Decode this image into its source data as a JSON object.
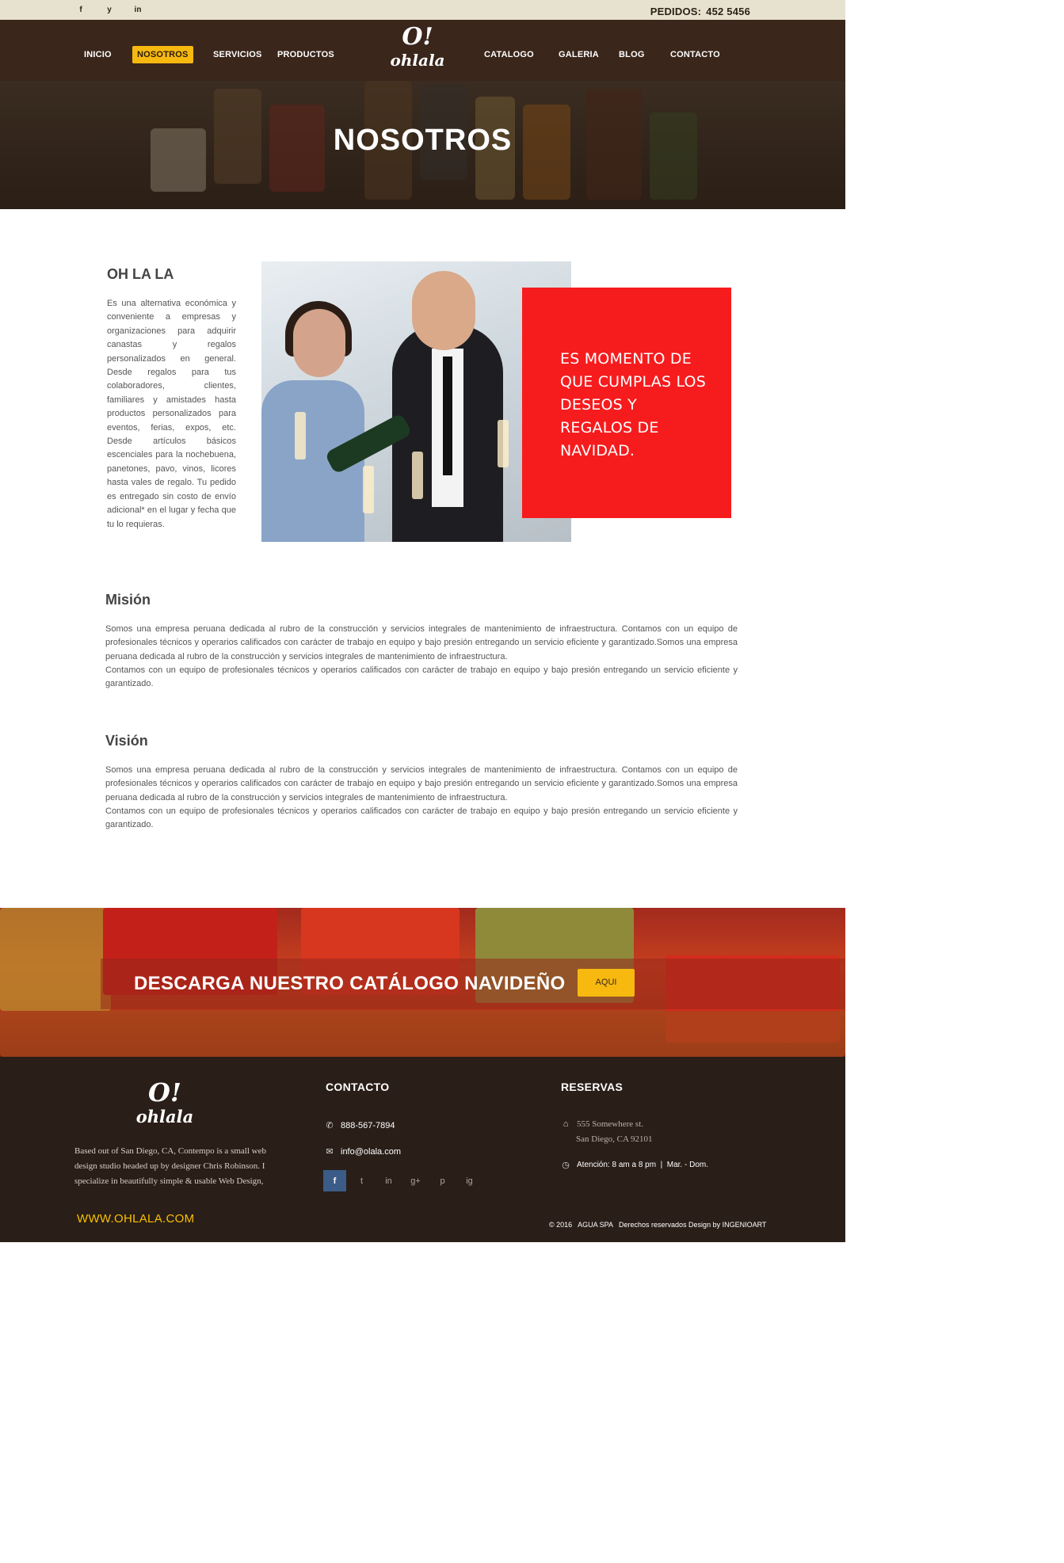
{
  "topbar": {
    "social": [
      "f",
      "y",
      "in"
    ],
    "pedidos_label": "PEDIDOS:",
    "pedidos_number": "452 5456"
  },
  "nav": {
    "items": [
      "INICIO",
      "NOSOTROS",
      "SERVICIOS",
      "PRODUCTOS",
      "CATALOGO",
      "GALERIA",
      "BLOG",
      "CONTACTO"
    ],
    "active": "NOSOTROS",
    "logo_mark": "O!",
    "logo_text": "ohlala"
  },
  "hero": {
    "title": "NOSOTROS"
  },
  "about": {
    "title": "OH LA LA",
    "text": "Es una alternativa económica y conveniente a empresas y organizaciones para adquirir canastas y regalos personalizados en general. Desde regalos para tus colaboradores, clientes, familiares y amistades hasta productos personalizados para eventos, ferias, expos, etc. Desde artículos básicos escenciales para la nochebuena, panetones, pavo, vinos, licores hasta vales de regalo. Tu pedido es entregado sin costo de envío adicional* en el lugar y fecha que tu lo requieras.",
    "highlight": "ES MOMENTO DE QUE CUMPLAS LOS DESEOS Y REGALOS DE NAVIDAD."
  },
  "mision": {
    "title": "Misión",
    "text": "Somos una empresa peruana dedicada al rubro de la construcción y servicios integrales de mantenimiento de infraestructura. Contamos con un equipo de profesionales técnicos y operarios calificados con carácter de trabajo en equipo y bajo presión entregando un servicio eficiente y garantizado.Somos una empresa peruana dedicada al rubro de la construcción y servicios integrales de mantenimiento de infraestructura.",
    "text2": "Contamos con un equipo de profesionales técnicos y operarios calificados con carácter de trabajo en equipo y bajo presión entregando un servicio eficiente y garantizado."
  },
  "vision": {
    "title": "Visión",
    "text": "Somos una empresa peruana dedicada al rubro de la construcción y servicios integrales de mantenimiento de infraestructura. Contamos con un equipo de profesionales técnicos y operarios calificados con carácter de trabajo en equipo y bajo presión entregando un servicio eficiente y garantizado.Somos una empresa peruana dedicada al rubro de la construcción y servicios integrales de mantenimiento de infraestructura.",
    "text2": "Contamos con un equipo de profesionales técnicos y operarios calificados con carácter de trabajo en equipo y bajo presión entregando un servicio eficiente y garantizado."
  },
  "banner": {
    "text": "DESCARGA NUESTRO CATÁLOGO NAVIDEÑO",
    "button": "AQUI"
  },
  "footer": {
    "logo_mark": "O!",
    "logo_text": "ohlala",
    "about": "Based out of San Diego, CA, Contempo is a small web design studio headed up by designer Chris Robinson. I specialize in beautifully simple & usable Web Design,",
    "website": "WWW.OHLALA.COM",
    "contacto_title": "CONTACTO",
    "phone": "888-567-7894",
    "email": "info@olala.com",
    "reservas_title": "RESERVAS",
    "address1": "555 Somewhere st.",
    "address2": "San Diego, CA 92101",
    "hours": "Atención: 8 am a 8 pm  |  Mar. - Dom.",
    "social": [
      "f",
      "t",
      "in",
      "g+",
      "p",
      "ig"
    ],
    "copyright": "© 2016   AGUA SPA   Derechos reservados Design by INGENIOART"
  },
  "colors": {
    "nav_bg": "#3a261b",
    "topbar_bg": "#e7e2cf",
    "accent_yellow": "#f7b90f",
    "highlight_red": "#f61c1e",
    "footer_bg": "#2a1e18"
  }
}
